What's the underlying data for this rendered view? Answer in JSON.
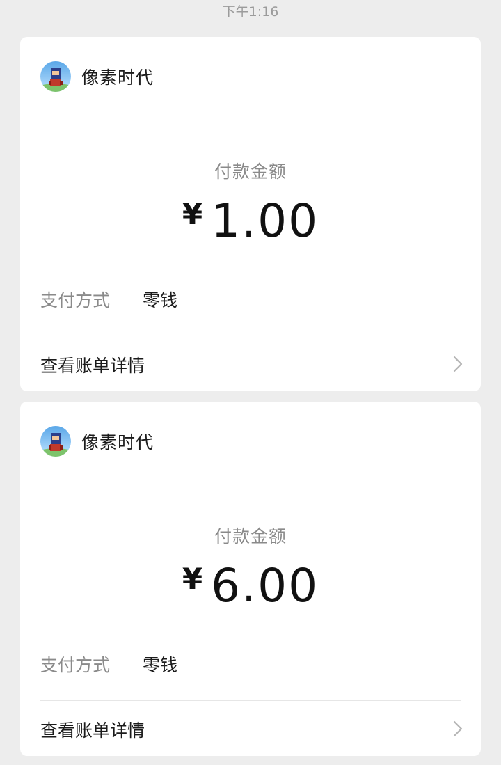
{
  "timestamp": "下午1:16",
  "cards": [
    {
      "merchant": "像素时代",
      "amount_label": "付款金额",
      "currency": "¥",
      "amount": "1.00",
      "method_label": "支付方式",
      "method_value": "零钱",
      "detail_label": "查看账单详情",
      "chevron_icon": "chevron-right-icon"
    },
    {
      "merchant": "像素时代",
      "amount_label": "付款金额",
      "currency": "¥",
      "amount": "6.00",
      "method_label": "支付方式",
      "method_value": "零钱",
      "detail_label": "查看账单详情",
      "chevron_icon": "chevron-right-icon"
    }
  ],
  "colors": {
    "background": "#ededed",
    "card": "#ffffff",
    "secondary_text": "#8a8a8a",
    "primary_text": "#1b1b1b"
  }
}
